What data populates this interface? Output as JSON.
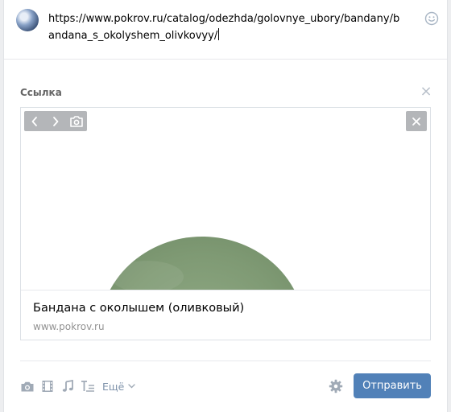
{
  "composer": {
    "text": "https://www.pokrov.ru/catalog/odezhda/golovnye_ubory/bandany/bandana_s_okolyshem_olivkovyy/",
    "avatar_icon": "user-avatar",
    "emoji_icon": "smile-icon"
  },
  "attachment": {
    "section_title": "Ссылка",
    "card": {
      "title": "Бандана с околышем (оливковый)",
      "domain": "www.pokrov.ru",
      "image_controls": [
        "prev-arrow-icon",
        "next-arrow-icon",
        "camera-icon"
      ],
      "remove_icon": "close-icon"
    }
  },
  "toolbar": {
    "items": [
      "camera-icon",
      "film-icon",
      "music-note-icon",
      "text-format-icon"
    ],
    "more_label": "Ещё",
    "settings_icon": "gear-icon",
    "send_label": "Отправить"
  },
  "colors": {
    "accent": "#5181b8",
    "link_muted": "#7f93ab",
    "icon_gray": "#a0aab6"
  }
}
